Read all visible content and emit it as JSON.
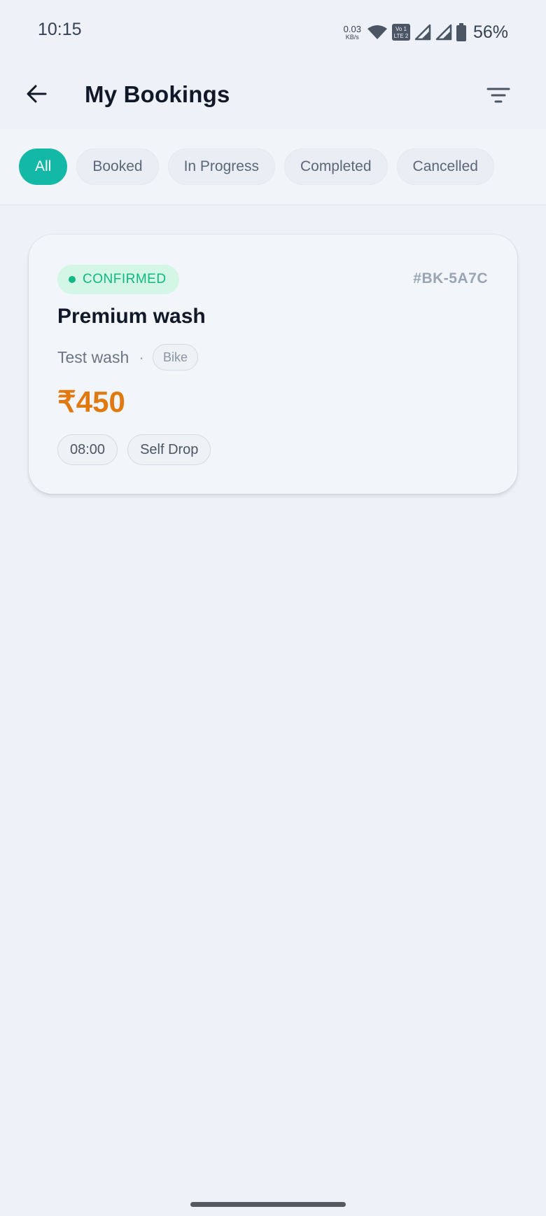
{
  "status_bar": {
    "time": "10:15",
    "net_speed_value": "0.03",
    "net_speed_unit": "KB/s",
    "battery": "56%",
    "icons": [
      "wifi-icon",
      "volte-icon",
      "signal-icon",
      "signal-icon",
      "battery-icon"
    ]
  },
  "header": {
    "title": "My Bookings",
    "back_icon": "arrow-left-icon",
    "filter_icon": "filter-lines-icon"
  },
  "tabs": [
    {
      "label": "All",
      "active": true
    },
    {
      "label": "Booked",
      "active": false
    },
    {
      "label": "In Progress",
      "active": false
    },
    {
      "label": "Completed",
      "active": false
    },
    {
      "label": "Cancelled",
      "active": false
    }
  ],
  "booking": {
    "status": "CONFIRMED",
    "id": "#BK-5A7C",
    "service": "Premium wash",
    "shop": "Test wash",
    "separator": "·",
    "vehicle": "Bike",
    "price": "₹450",
    "time": "08:00",
    "mode": "Self Drop"
  },
  "colors": {
    "accent": "#14b8a6",
    "confirmed": "#10b981",
    "price": "#e07a10",
    "background": "#eef2f8"
  }
}
